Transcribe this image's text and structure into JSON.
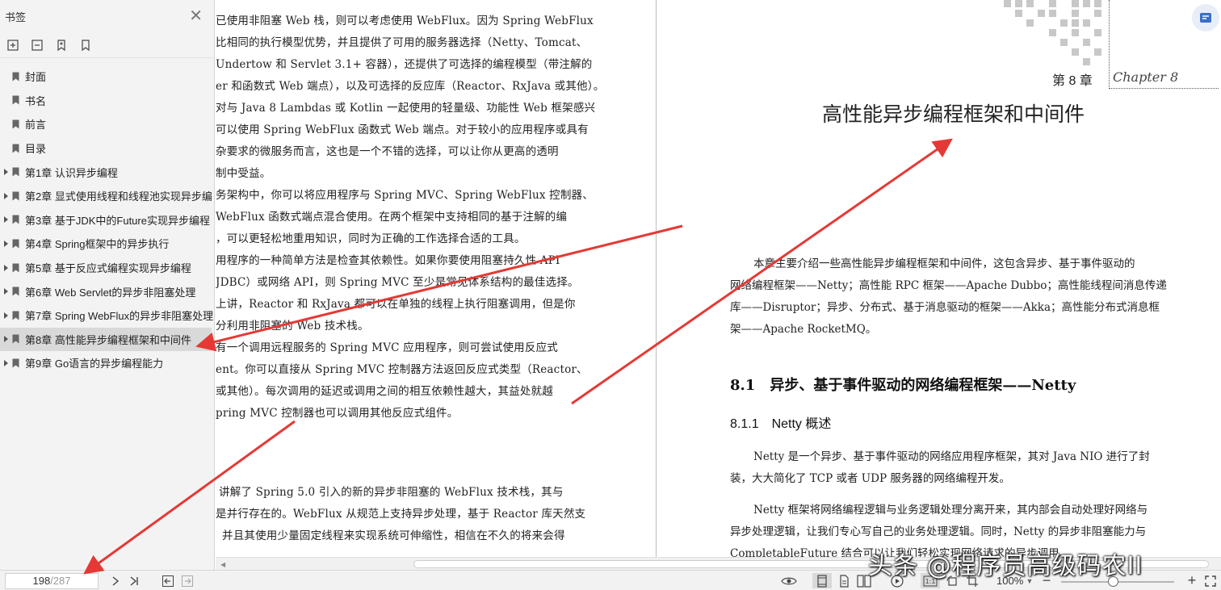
{
  "sidebar": {
    "title": "书签",
    "close_glyph": "✕",
    "items": [
      {
        "label": "封面",
        "expandable": false
      },
      {
        "label": "书名",
        "expandable": false
      },
      {
        "label": "前言",
        "expandable": false
      },
      {
        "label": "目录",
        "expandable": false
      },
      {
        "label": "第1章 认识异步编程",
        "expandable": true
      },
      {
        "label": "第2章 显式使用线程和线程池实现异步编",
        "expandable": true
      },
      {
        "label": "第3章 基于JDK中的Future实现异步编程",
        "expandable": true
      },
      {
        "label": "第4章 Spring框架中的异步执行",
        "expandable": true
      },
      {
        "label": "第5章 基于反应式编程实现异步编程",
        "expandable": true
      },
      {
        "label": "第6章 Web Servlet的异步非阻塞处理",
        "expandable": true
      },
      {
        "label": "第7章 Spring WebFlux的异步非阻塞处理",
        "expandable": true
      },
      {
        "label": "第8章 高性能异步编程框架和中间件",
        "expandable": true,
        "active": true
      },
      {
        "label": "第9章 Go语言的异步编程能力",
        "expandable": true
      }
    ]
  },
  "left_page": {
    "lines": [
      "已使用非阻塞 Web 栈，则可以考虑使用 WebFlux。因为 Spring WebFlux",
      "比相同的执行模型优势，并且提供了可用的服务器选择（Netty、Tomcat、",
      "Undertow 和 Servlet 3.1+ 容器），还提供了可选择的编程模型（带注解的",
      "er 和函数式 Web 端点），以及可选择的反应库（Reactor、RxJava 或其他）。",
      "对与 Java 8 Lambdas 或 Kotlin 一起使用的轻量级、功能性 Web 框架感兴",
      "可以使用 Spring WebFlux 函数式 Web 端点。对于较小的应用程序或具有",
      "杂要求的微服务而言，这也是一个不错的选择，可以让你从更高的透明",
      "制中受益。",
      "务架构中，你可以将应用程序与 Spring MVC、Spring WebFlux 控制器、",
      "WebFlux 函数式端点混合使用。在两个框架中支持相同的基于注解的编",
      "，可以更轻松地重用知识，同时为正确的工作选择合适的工具。",
      "用程序的一种简单方法是检查其依赖性。如果你要使用阻塞持久性 API",
      "JDBC）或网络 API，则 Spring MVC 至少是常见体系结构的最佳选择。",
      "上讲，Reactor 和 RxJava 都可以在单独的线程上执行阻塞调用，但是你",
      "分利用非阻塞的 Web 技术栈。",
      "有一个调用远程服务的 Spring MVC 应用程序，则可尝试使用反应式",
      "ent。你可以直接从 Spring MVC 控制器方法返回反应式类型（Reactor、",
      "或其他）。每次调用的延迟或调用之间的相互依赖性越大，其益处就越",
      "pring MVC 控制器也可以调用其他反应式组件。",
      "讲解了 Spring 5.0 引入的新的异步非阻塞的 WebFlux 技术栈，其与",
      "是并行存在的。WebFlux 从规范上支持异步处理，基于 Reactor 库天然支",
      "并且其使用少量固定线程来实现系统可伸缩性，相信在不久的将来会得"
    ]
  },
  "right_page": {
    "chapter_number": "第 8 章",
    "chapter_en": "Chapter 8",
    "chapter_title": "高性能异步编程框架和中间件",
    "intro_lines": [
      "本章主要介绍一些高性能异步编程框架和中间件，这包含异步、基于事件驱动的",
      "网络编程框架——Netty；高性能 RPC 框架——Apache Dubbo；高性能线程间消息传递",
      "库——Disruptor；异步、分布式、基于消息驱动的框架——Akka；高性能分布式消息框",
      "架——Apache RocketMQ。"
    ],
    "section_81": "8.1　异步、基于事件驱动的网络编程框架——Netty",
    "section_811": "8.1.1　Netty 概述",
    "para1_lines": [
      "Netty 是一个异步、基于事件驱动的网络应用程序框架，其对 Java NIO 进行了封",
      "装，大大简化了 TCP 或者 UDP 服务器的网络编程开发。"
    ],
    "para2_lines": [
      "Netty 框架将网络编程逻辑与业务逻辑处理分离开来，其内部会自动处理好网络与",
      "异步处理逻辑，让我们专心写自己的业务处理逻辑。同时，Netty 的异步非阻塞能力与",
      "CompletableFuture 结合可以让我们轻松实现网络请求的异步调用。"
    ]
  },
  "statusbar": {
    "current_page": "198",
    "total_pages": "/287",
    "zoom": "100%",
    "zoom_fraction": 0.46
  },
  "watermark": "头条 @程序员高级码农II",
  "colors": {
    "arrow": "#e53935",
    "sidebar_bg": "#f3f3f3",
    "active_item": "#d9d9d9"
  }
}
